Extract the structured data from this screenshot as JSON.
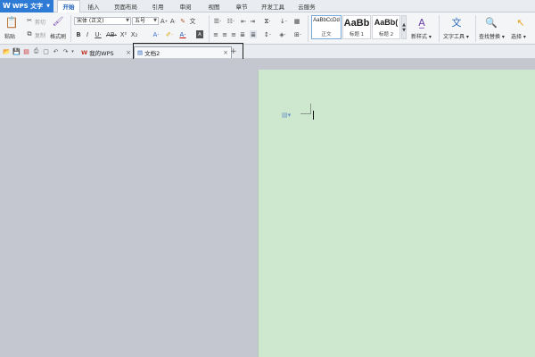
{
  "app": {
    "name": "WPS 文字",
    "logo_glyph": "W"
  },
  "menu": {
    "tabs": [
      "开始",
      "插入",
      "页面布局",
      "引用",
      "审阅",
      "视图",
      "章节",
      "开发工具",
      "云服务"
    ],
    "active_tab": "开始"
  },
  "ribbon": {
    "clipboard": {
      "paste": "粘贴",
      "cut": "剪切",
      "copy": "复制",
      "format_painter": "格式刷"
    },
    "font": {
      "family": "宋体 (正文)",
      "size": "五号"
    },
    "styles": [
      {
        "sample": "AaBbCcDd",
        "label": "正文"
      },
      {
        "sample": "AaBb",
        "label": "标题 1"
      },
      {
        "sample": "AaBb(",
        "label": "标题 2"
      }
    ],
    "new_style": "新样式",
    "text_tools": "文字工具",
    "find_replace": "查找替换",
    "select": "选择"
  },
  "tabs": {
    "docs": [
      {
        "label": "我的WPS"
      },
      {
        "label": "文档2"
      }
    ],
    "add": "+"
  },
  "colors": {
    "accent": "#2e7bd5",
    "page": "#cde8cf",
    "workspace": "#c4c7cf"
  }
}
